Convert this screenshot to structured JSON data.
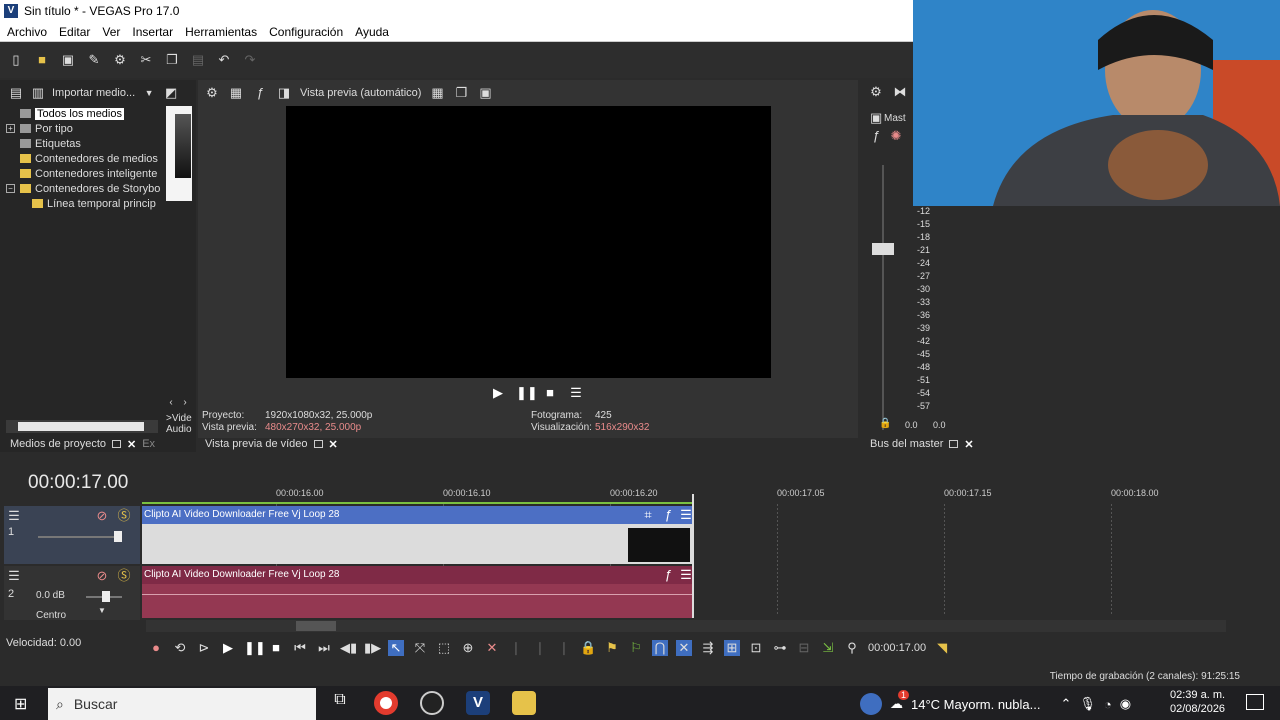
{
  "window": {
    "title": "Sin título * - VEGAS Pro 17.0",
    "logo": "V"
  },
  "menu": [
    "Archivo",
    "Editar",
    "Ver",
    "Insertar",
    "Herramientas",
    "Configuración",
    "Ayuda"
  ],
  "explorer": {
    "import_label": "Importar medio...",
    "tree": [
      {
        "label": "Todos los medios",
        "selected": true,
        "expander": ""
      },
      {
        "label": "Por tipo",
        "expander": "+"
      },
      {
        "label": "Etiquetas",
        "expander": ""
      },
      {
        "label": "Contenedores de medios",
        "expander": ""
      },
      {
        "label": "Contenedores inteligente",
        "expander": ""
      },
      {
        "label": "Contenedores de Storybo",
        "expander": "−"
      },
      {
        "label": "Línea temporal princip",
        "expander": ""
      }
    ],
    "side_labels": [
      ">Vide",
      "Audio"
    ],
    "tabs": {
      "project_media": "Medios de proyecto",
      "explorer_short": "Ex"
    }
  },
  "preview": {
    "mode_label": "Vista previa (automático)",
    "project_label": "Proyecto:",
    "project_value": "1920x1080x32, 25.000p",
    "preview_label": "Vista previa:",
    "preview_value": "480x270x32, 25.000p",
    "frame_label": "Fotograma:",
    "frame_value": "425",
    "display_label": "Visualización:",
    "display_value": "516x290x32",
    "tab": "Vista previa de vídeo"
  },
  "master": {
    "label": "Mast",
    "tab": "Bus del master",
    "scale": [
      "-12",
      "-15",
      "-18",
      "-21",
      "-24",
      "-27",
      "-30",
      "-33",
      "-36",
      "-39",
      "-42",
      "-45",
      "-48",
      "-51",
      "-54",
      "-57"
    ],
    "readout_l": "0.0",
    "readout_r": "0.0"
  },
  "timeline": {
    "timecode": "00:00:17.00",
    "ruler": [
      "00:00:16.00",
      "00:00:16.10",
      "00:00:16.20",
      "00:00:17.05",
      "00:00:17.15",
      "00:00:18.00"
    ],
    "tracks": [
      {
        "number": "1",
        "clip": "Clipto AI Video Downloader Free Vj Loop 28"
      },
      {
        "number": "2",
        "clip": "Clipto AI Video Downloader Free Vj Loop 28",
        "volume": "0.0 dB",
        "pan": "Centro"
      }
    ],
    "rate": "Velocidad: 0.00",
    "cursor_time": "00:00:17.00",
    "record_time": "Tiempo de grabación (2 canales): 91:25:15"
  },
  "taskbar": {
    "search": "Buscar",
    "weather": "14°C  Mayorm. nubla...",
    "badge": "1",
    "time": "02:39 a. m.",
    "date": "02/08/2026"
  }
}
